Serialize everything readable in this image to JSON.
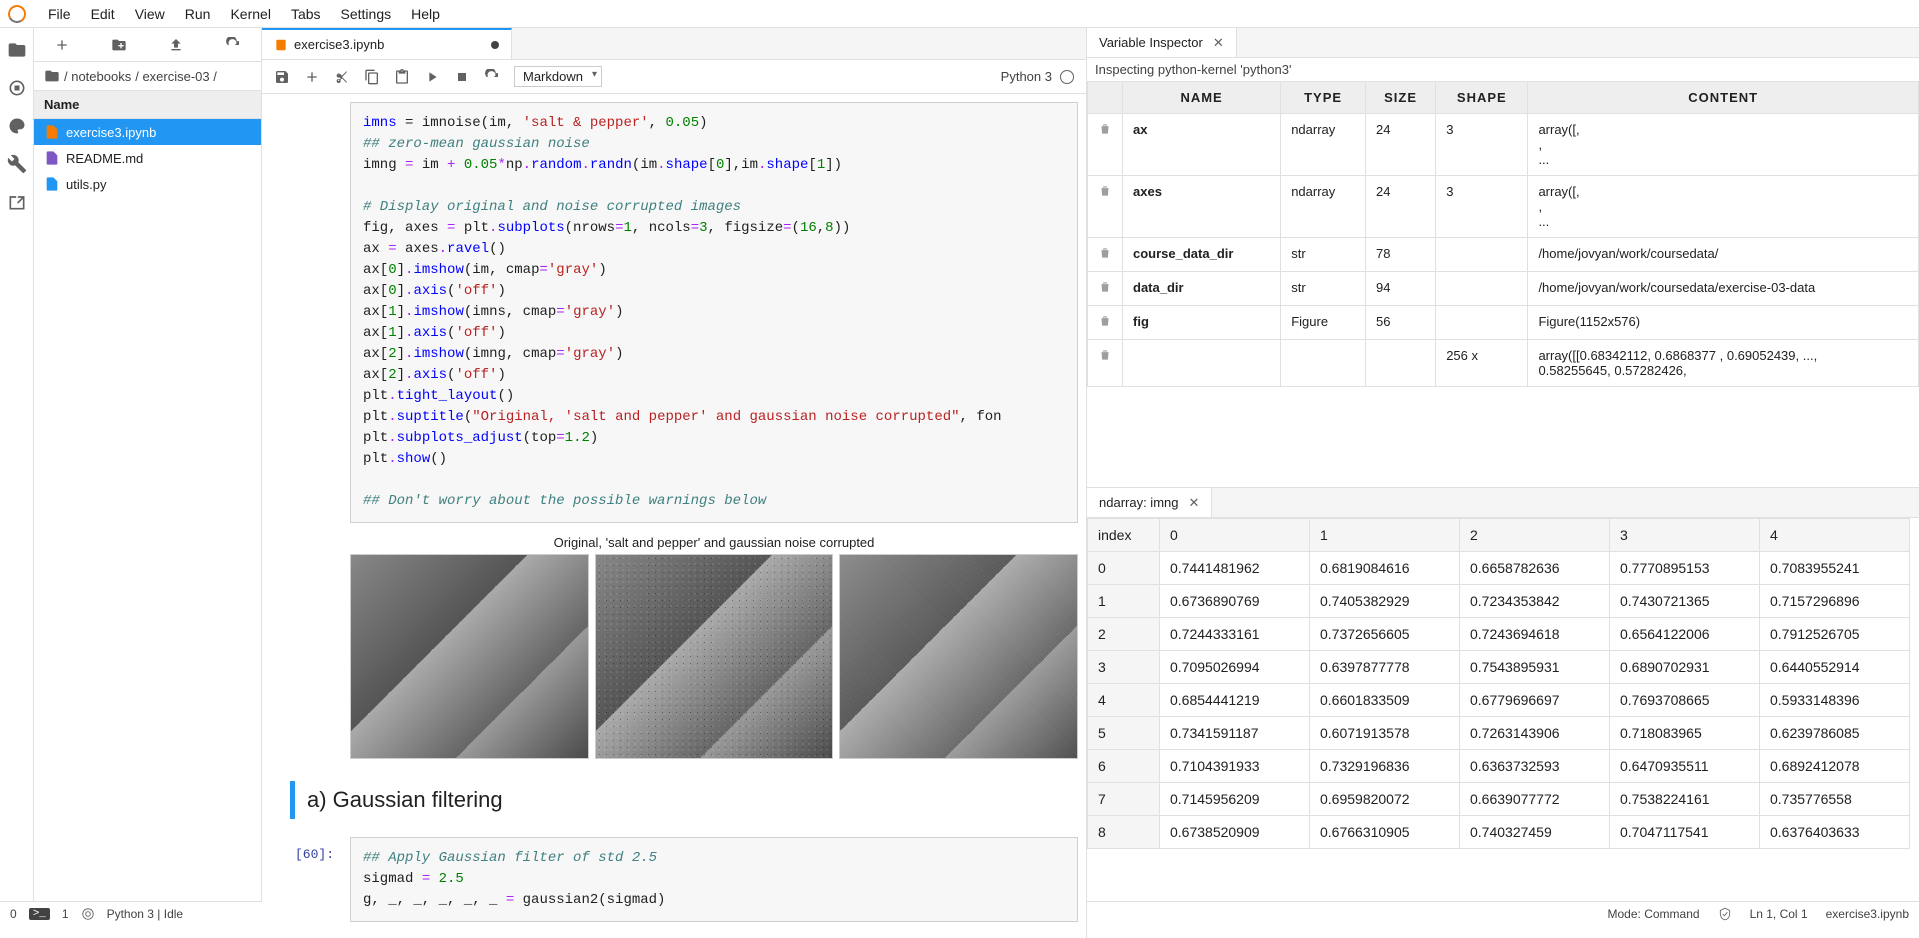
{
  "menubar": [
    "File",
    "Edit",
    "View",
    "Run",
    "Kernel",
    "Tabs",
    "Settings",
    "Help"
  ],
  "breadcrumbs": {
    "path1": "/ notebooks",
    "path2": "/ exercise-03 /"
  },
  "filebrowser": {
    "header": "Name",
    "items": [
      {
        "name": "exercise3.ipynb",
        "type": "notebook",
        "selected": true
      },
      {
        "name": "README.md",
        "type": "markdown",
        "selected": false
      },
      {
        "name": "utils.py",
        "type": "python",
        "selected": false
      }
    ]
  },
  "notebook": {
    "tab": "exercise3.ipynb",
    "kernel": "Python 3",
    "cellType": "Markdown",
    "figTitle": "Original, 'salt and pepper' and gaussian noise corrupted",
    "mdHeading": "a) Gaussian filtering",
    "prompt2": "[60]:"
  },
  "code1_lines": [
    [
      [
        "n",
        "imns"
      ],
      [
        "p",
        " = imnoise(im, "
      ],
      [
        "s",
        "'salt & pepper'"
      ],
      [
        "p",
        ", "
      ],
      [
        "m",
        "0.05"
      ],
      [
        "p",
        ")"
      ]
    ],
    [
      [
        "c",
        "## zero-mean gaussian noise"
      ]
    ],
    [
      [
        "p",
        "imng "
      ],
      [
        "o",
        "="
      ],
      [
        "p",
        " im "
      ],
      [
        "o",
        "+"
      ],
      [
        "p",
        " "
      ],
      [
        "m",
        "0.05"
      ],
      [
        "o",
        "*"
      ],
      [
        "p",
        "np"
      ],
      [
        "o",
        "."
      ],
      [
        "n",
        "random"
      ],
      [
        "o",
        "."
      ],
      [
        "n",
        "randn"
      ],
      [
        "p",
        "(im"
      ],
      [
        "o",
        "."
      ],
      [
        "n",
        "shape"
      ],
      [
        "p",
        "["
      ],
      [
        "m",
        "0"
      ],
      [
        "p",
        "],im"
      ],
      [
        "o",
        "."
      ],
      [
        "n",
        "shape"
      ],
      [
        "p",
        "["
      ],
      [
        "m",
        "1"
      ],
      [
        "p",
        "])"
      ]
    ],
    [
      [
        "p",
        ""
      ]
    ],
    [
      [
        "c",
        "# Display original and noise corrupted images"
      ]
    ],
    [
      [
        "p",
        "fig, axes "
      ],
      [
        "o",
        "="
      ],
      [
        "p",
        " plt"
      ],
      [
        "o",
        "."
      ],
      [
        "n",
        "subplots"
      ],
      [
        "p",
        "(nrows"
      ],
      [
        "o",
        "="
      ],
      [
        "m",
        "1"
      ],
      [
        "p",
        ", ncols"
      ],
      [
        "o",
        "="
      ],
      [
        "m",
        "3"
      ],
      [
        "p",
        ", figsize"
      ],
      [
        "o",
        "="
      ],
      [
        "p",
        "("
      ],
      [
        "m",
        "16"
      ],
      [
        "p",
        ","
      ],
      [
        "m",
        "8"
      ],
      [
        "p",
        "))"
      ]
    ],
    [
      [
        "p",
        "ax "
      ],
      [
        "o",
        "="
      ],
      [
        "p",
        " axes"
      ],
      [
        "o",
        "."
      ],
      [
        "n",
        "ravel"
      ],
      [
        "p",
        "()"
      ]
    ],
    [
      [
        "p",
        "ax["
      ],
      [
        "m",
        "0"
      ],
      [
        "p",
        "]"
      ],
      [
        "o",
        "."
      ],
      [
        "n",
        "imshow"
      ],
      [
        "p",
        "(im, cmap"
      ],
      [
        "o",
        "="
      ],
      [
        "s",
        "'gray'"
      ],
      [
        "p",
        ")"
      ]
    ],
    [
      [
        "p",
        "ax["
      ],
      [
        "m",
        "0"
      ],
      [
        "p",
        "]"
      ],
      [
        "o",
        "."
      ],
      [
        "n",
        "axis"
      ],
      [
        "p",
        "("
      ],
      [
        "s",
        "'off'"
      ],
      [
        "p",
        ")"
      ]
    ],
    [
      [
        "p",
        "ax["
      ],
      [
        "m",
        "1"
      ],
      [
        "p",
        "]"
      ],
      [
        "o",
        "."
      ],
      [
        "n",
        "imshow"
      ],
      [
        "p",
        "(imns, cmap"
      ],
      [
        "o",
        "="
      ],
      [
        "s",
        "'gray'"
      ],
      [
        "p",
        ")"
      ]
    ],
    [
      [
        "p",
        "ax["
      ],
      [
        "m",
        "1"
      ],
      [
        "p",
        "]"
      ],
      [
        "o",
        "."
      ],
      [
        "n",
        "axis"
      ],
      [
        "p",
        "("
      ],
      [
        "s",
        "'off'"
      ],
      [
        "p",
        ")"
      ]
    ],
    [
      [
        "p",
        "ax["
      ],
      [
        "m",
        "2"
      ],
      [
        "p",
        "]"
      ],
      [
        "o",
        "."
      ],
      [
        "n",
        "imshow"
      ],
      [
        "p",
        "(imng, cmap"
      ],
      [
        "o",
        "="
      ],
      [
        "s",
        "'gray'"
      ],
      [
        "p",
        ")"
      ]
    ],
    [
      [
        "p",
        "ax["
      ],
      [
        "m",
        "2"
      ],
      [
        "p",
        "]"
      ],
      [
        "o",
        "."
      ],
      [
        "n",
        "axis"
      ],
      [
        "p",
        "("
      ],
      [
        "s",
        "'off'"
      ],
      [
        "p",
        ")"
      ]
    ],
    [
      [
        "p",
        "plt"
      ],
      [
        "o",
        "."
      ],
      [
        "n",
        "tight_layout"
      ],
      [
        "p",
        "()"
      ]
    ],
    [
      [
        "p",
        "plt"
      ],
      [
        "o",
        "."
      ],
      [
        "n",
        "suptitle"
      ],
      [
        "p",
        "("
      ],
      [
        "s",
        "\"Original, 'salt and pepper' and gaussian noise corrupted\""
      ],
      [
        "p",
        ", fon"
      ]
    ],
    [
      [
        "p",
        "plt"
      ],
      [
        "o",
        "."
      ],
      [
        "n",
        "subplots_adjust"
      ],
      [
        "p",
        "(top"
      ],
      [
        "o",
        "="
      ],
      [
        "m",
        "1.2"
      ],
      [
        "p",
        ")"
      ]
    ],
    [
      [
        "p",
        "plt"
      ],
      [
        "o",
        "."
      ],
      [
        "n",
        "show"
      ],
      [
        "p",
        "()"
      ]
    ],
    [
      [
        "p",
        ""
      ]
    ],
    [
      [
        "c",
        "## Don't worry about the possible warnings below"
      ]
    ]
  ],
  "code2_lines": [
    [
      [
        "c",
        "## Apply Gaussian filter of std 2.5"
      ]
    ],
    [
      [
        "p",
        "sigmad "
      ],
      [
        "o",
        "="
      ],
      [
        "p",
        " "
      ],
      [
        "m",
        "2.5"
      ]
    ],
    [
      [
        "p",
        "g, _, _, _, _, _ "
      ],
      [
        "o",
        "="
      ],
      [
        "p",
        " gaussian2(sigmad)"
      ]
    ]
  ],
  "varinspector": {
    "title": "Variable Inspector",
    "subtitle": "Inspecting python-kernel 'python3'",
    "headers": [
      "",
      "NAME",
      "TYPE",
      "SIZE",
      "SHAPE",
      "CONTENT"
    ],
    "rows": [
      {
        "name": "ax",
        "type": "ndarray",
        "size": "24",
        "shape": "3",
        "content": "array([,\n,\n..."
      },
      {
        "name": "axes",
        "type": "ndarray",
        "size": "24",
        "shape": "3",
        "content": "array([,\n,\n..."
      },
      {
        "name": "course_data_dir",
        "type": "str",
        "size": "78",
        "shape": "",
        "content": "/home/jovyan/work/coursedata/"
      },
      {
        "name": "data_dir",
        "type": "str",
        "size": "94",
        "shape": "",
        "content": "/home/jovyan/work/coursedata/exercise-03-data"
      },
      {
        "name": "fig",
        "type": "Figure",
        "size": "56",
        "shape": "",
        "content": "Figure(1152x576)"
      },
      {
        "name": "",
        "type": "",
        "size": "",
        "shape": "256 x",
        "content": "array([[0.68342112, 0.6868377 , 0.69052439, ...,\n0.58255645, 0.57282426,"
      }
    ]
  },
  "ndarray": {
    "title": "ndarray: imng",
    "headers": [
      "index",
      "0",
      "1",
      "2",
      "3",
      "4"
    ],
    "rows": [
      [
        "0",
        "0.7441481962",
        "0.6819084616",
        "0.6658782636",
        "0.7770895153",
        "0.7083955241"
      ],
      [
        "1",
        "0.6736890769",
        "0.7405382929",
        "0.7234353842",
        "0.7430721365",
        "0.7157296896"
      ],
      [
        "2",
        "0.7244333161",
        "0.7372656605",
        "0.7243694618",
        "0.6564122006",
        "0.7912526705"
      ],
      [
        "3",
        "0.7095026994",
        "0.6397877778",
        "0.7543895931",
        "0.6890702931",
        "0.6440552914"
      ],
      [
        "4",
        "0.6854441219",
        "0.6601833509",
        "0.6779696697",
        "0.7693708665",
        "0.5933148396"
      ],
      [
        "5",
        "0.7341591187",
        "0.6071913578",
        "0.7263143906",
        "0.718083965",
        "0.6239786085"
      ],
      [
        "6",
        "0.7104391933",
        "0.7329196836",
        "0.6363732593",
        "0.6470935511",
        "0.6892412078"
      ],
      [
        "7",
        "0.7145956209",
        "0.6959820072",
        "0.6639077772",
        "0.7538224161",
        "0.735776558"
      ],
      [
        "8",
        "0.6738520909",
        "0.6766310905",
        "0.740327459",
        "0.7047117541",
        "0.6376403633"
      ]
    ]
  },
  "statusbar": {
    "left0": "0",
    "left1": "1",
    "kernel": "Python 3 | Idle",
    "mode": "Mode: Command",
    "pos": "Ln 1, Col 1",
    "file": "exercise3.ipynb"
  }
}
